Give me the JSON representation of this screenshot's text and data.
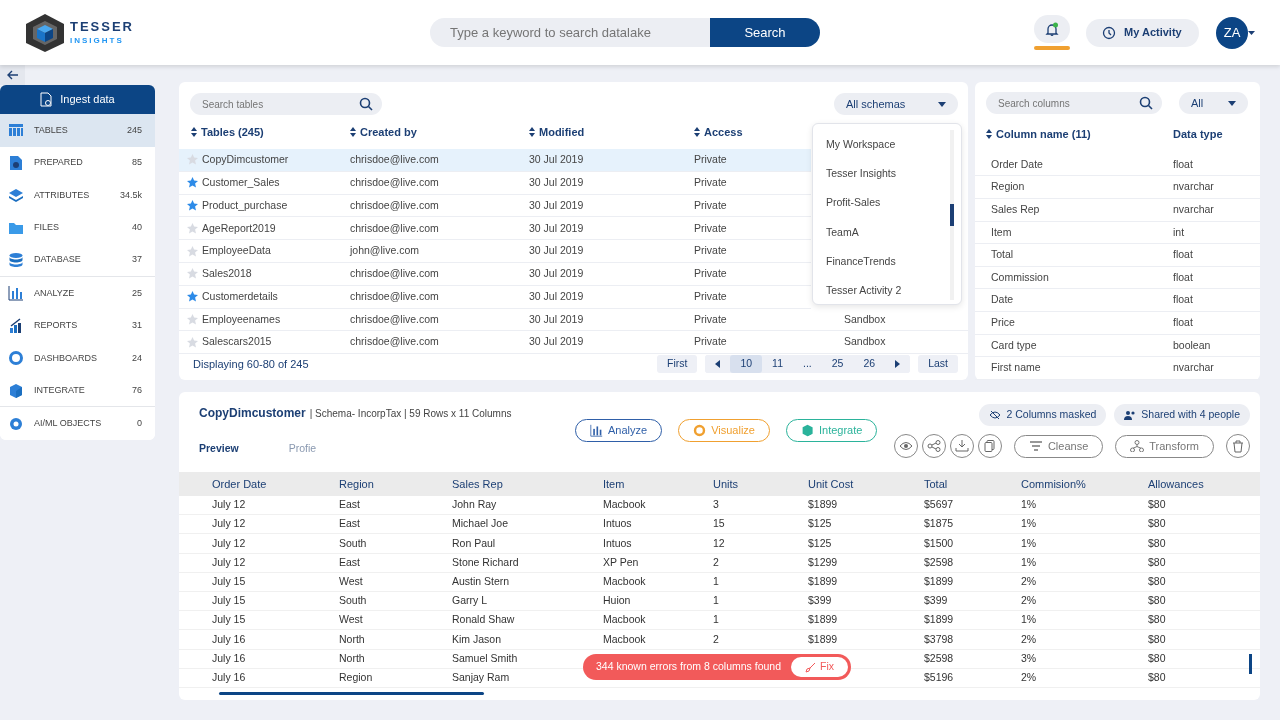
{
  "header": {
    "logo_title": "TESSER",
    "logo_subtitle": "INSIGHTS",
    "search": {
      "placeholder": "Type a keyword to search datalake"
    },
    "search_button": "Search",
    "notifications": {
      "unread": true
    },
    "activity_button": "My Activity",
    "avatar": "ZA"
  },
  "sidebar": {
    "ingest_button": "Ingest data",
    "items": [
      {
        "label": "TABLES",
        "count": "245",
        "selected": true
      },
      {
        "label": "PREPARED",
        "count": "85",
        "selected": false
      },
      {
        "label": "ATTRIBUTES",
        "count": "34.5k",
        "selected": false
      },
      {
        "label": "FILES",
        "count": "40",
        "selected": false
      },
      {
        "label": "DATABASE",
        "count": "37",
        "selected": false
      },
      {
        "label": "ANALYZE",
        "count": "25",
        "selected": false
      },
      {
        "label": "REPORTS",
        "count": "31",
        "selected": false
      },
      {
        "label": "DASHBOARDS",
        "count": "24",
        "selected": false
      },
      {
        "label": "INTEGRATE",
        "count": "76",
        "selected": false
      },
      {
        "label": "AI/ML OBJECTS",
        "count": "0",
        "selected": false
      }
    ]
  },
  "tables_panel": {
    "search": {
      "placeholder": "Search tables"
    },
    "schema_select": "All schemas",
    "columns": [
      "Tables (245)",
      "Created by",
      "Modified",
      "Access"
    ],
    "rows": [
      {
        "name": "CopyDimcustomer",
        "starred": false,
        "selected": true,
        "created_by": "chrisdoe@live.com",
        "modified": "30 Jul 2019",
        "access": "Private",
        "column_5": null
      },
      {
        "name": "Customer_Sales",
        "starred": true,
        "selected": false,
        "created_by": "chrisdoe@live.com",
        "modified": "30 Jul 2019",
        "access": "Private",
        "column_5": null
      },
      {
        "name": "Product_purchase",
        "starred": true,
        "selected": false,
        "created_by": "chrisdoe@live.com",
        "modified": "30 Jul 2019",
        "access": "Private",
        "column_5": null
      },
      {
        "name": "AgeReport2019",
        "starred": false,
        "selected": false,
        "created_by": "chrisdoe@live.com",
        "modified": "30 Jul 2019",
        "access": "Private",
        "column_5": null
      },
      {
        "name": "EmployeeData",
        "starred": false,
        "selected": false,
        "created_by": "john@live.com",
        "modified": "30 Jul 2019",
        "access": "Private",
        "column_5": null
      },
      {
        "name": "Sales2018",
        "starred": false,
        "selected": false,
        "created_by": "chrisdoe@live.com",
        "modified": "30 Jul 2019",
        "access": "Private",
        "column_5": null
      },
      {
        "name": "Customerdetails",
        "starred": true,
        "selected": false,
        "created_by": "chrisdoe@live.com",
        "modified": "30 Jul 2019",
        "access": "Private",
        "column_5": null
      },
      {
        "name": "Employeenames",
        "starred": false,
        "selected": false,
        "created_by": "chrisdoe@live.com",
        "modified": "30 Jul 2019",
        "access": "Private",
        "column_5": "Sandbox"
      },
      {
        "name": "Salescars2015",
        "starred": false,
        "selected": false,
        "created_by": "chrisdoe@live.com",
        "modified": "30 Jul 2019",
        "access": "Private",
        "column_5": "Sandbox"
      }
    ],
    "footer": "Displaying 60-80 of 245",
    "pagination": {
      "first": "First",
      "last": "Last",
      "pages": [
        {
          "label": "10",
          "selected": true
        },
        {
          "label": "11",
          "selected": false
        },
        {
          "label": "...",
          "selected": false
        },
        {
          "label": "25",
          "selected": false
        },
        {
          "label": "26",
          "selected": false
        }
      ]
    },
    "schema_dropdown": [
      "My Workspace",
      "Tesser Insights",
      "Profit-Sales",
      "TeamA",
      "FinanceTrends",
      "Tesser Activity 2"
    ]
  },
  "columns_panel": {
    "search": {
      "placeholder": "Search columns"
    },
    "type_select": "All",
    "columns": [
      "Column name (11)",
      "Data type"
    ],
    "rows": [
      [
        "Order Date",
        "float"
      ],
      [
        "Region",
        "nvarchar"
      ],
      [
        "Sales Rep",
        "nvarchar"
      ],
      [
        "Item",
        "int"
      ],
      [
        "Total",
        "float"
      ],
      [
        "Commission",
        "float"
      ],
      [
        "Date",
        "float"
      ],
      [
        "Price",
        "float"
      ],
      [
        "Card type",
        "boolean"
      ],
      [
        "First name",
        "nvarchar"
      ]
    ]
  },
  "preview": {
    "title": "CopyDimcustomer",
    "meta": "| Schema- IncorpTax | 59 Rows x 11 Columns",
    "actions": [
      {
        "label": "Analyze",
        "color": "#2f5fa8"
      },
      {
        "label": "Visualize",
        "color": "#f0a030"
      },
      {
        "label": "Integrate",
        "color": "#2bb39b"
      }
    ],
    "masked": "2 Columns masked",
    "shared": "Shared with 4 people",
    "tabs": [
      {
        "label": "Preview",
        "selected": true
      },
      {
        "label": "Profie",
        "selected": false
      }
    ],
    "tools": [
      "Cleanse",
      "Transform"
    ],
    "columns": [
      "Order Date",
      "Region",
      "Sales Rep",
      "Item",
      "Units",
      "Unit Cost",
      "Total",
      "Commision%",
      "Allowances"
    ],
    "rows": [
      [
        "July 12",
        "East",
        "John Ray",
        "Macbook",
        "3",
        "$1899",
        "$5697",
        "1%",
        "$80"
      ],
      [
        "July 12",
        "East",
        "Michael Joe",
        "Intuos",
        "15",
        "$125",
        "$1875",
        "1%",
        "$80"
      ],
      [
        "July 12",
        "South",
        "Ron Paul",
        "Intuos",
        "12",
        "$125",
        "$1500",
        "1%",
        "$80"
      ],
      [
        "July 12",
        "East",
        "Stone Richard",
        "XP Pen",
        "2",
        "$1299",
        "$2598",
        "1%",
        "$80"
      ],
      [
        "July 15",
        "West",
        "Austin Stern",
        "Macbook",
        "1",
        "$1899",
        "$1899",
        "2%",
        "$80"
      ],
      [
        "July 15",
        "South",
        "Garry L",
        "Huion",
        "1",
        "$399",
        "$399",
        "2%",
        "$80"
      ],
      [
        "July 15",
        "West",
        "Ronald Shaw",
        "Macbook",
        "1",
        "$1899",
        "$1899",
        "1%",
        "$80"
      ],
      [
        "July 16",
        "North",
        "Kim Jason",
        "Macbook",
        "2",
        "$1899",
        "$3798",
        "2%",
        "$80"
      ],
      [
        "July 16",
        "North",
        "Samuel Smith",
        null,
        null,
        null,
        "$2598",
        "3%",
        "$80"
      ],
      [
        "July 16",
        "Region",
        "Sanjay Ram",
        null,
        null,
        null,
        "$5196",
        "2%",
        "$80"
      ]
    ],
    "toast": {
      "message": "344 known errors from 8 columns found",
      "button": "Fix"
    }
  }
}
